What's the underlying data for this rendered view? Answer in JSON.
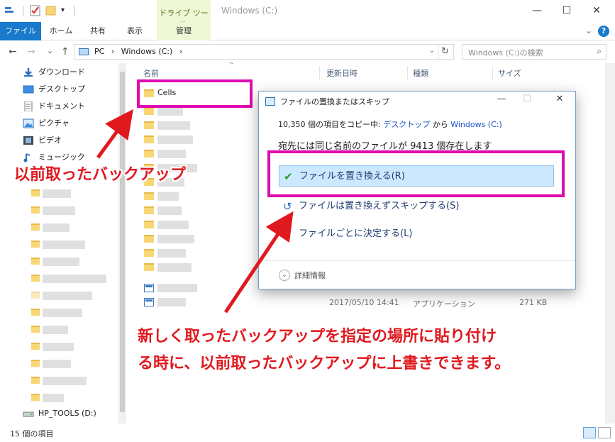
{
  "window": {
    "title": "Windows (C:)",
    "tool_tab": "ドライブ ツール",
    "min": "—",
    "max": "☐",
    "close": "✕"
  },
  "ribbon": {
    "file": "ファイル",
    "home": "ホーム",
    "share": "共有",
    "view": "表示",
    "manage": "管理",
    "chevron": "⌄",
    "help": "?"
  },
  "nav": {
    "back": "←",
    "forward": "→",
    "recent": "⌄",
    "up": "↑",
    "crumbs": [
      "PC",
      "›",
      "Windows (C:)",
      "›"
    ],
    "search_placeholder": "Windows (C:)の検索"
  },
  "sidebar": {
    "items": [
      {
        "label": "ダウンロード",
        "icon": "download-icon"
      },
      {
        "label": "デスクトップ",
        "icon": "desktop-icon"
      },
      {
        "label": "ドキュメント",
        "icon": "documents-icon"
      },
      {
        "label": "ピクチャ",
        "icon": "pictures-icon"
      },
      {
        "label": "ビデオ",
        "icon": "video-icon"
      },
      {
        "label": "ミュージック",
        "icon": "music-icon"
      }
    ],
    "drive": "HP_TOOLS (D:)"
  },
  "columns": {
    "name": "名前",
    "date": "更新日時",
    "type": "種類",
    "size": "サイズ"
  },
  "files": {
    "first_folder": "Cells",
    "last_row": {
      "date": "2017/05/10 14:41",
      "type": "アプリケーション",
      "size": "271 KB"
    }
  },
  "dialog": {
    "title": "ファイルの置換またはスキップ",
    "copying_prefix": "10,350 個の項目をコピー中:",
    "from": "デスクトップ",
    "from_word": "から",
    "to": "Windows (C:)",
    "exists": "宛先には同じ名前のファイルが 9413 個存在します",
    "options": [
      "ファイルを置き換える(R)",
      "ファイルは置き換えずスキップする(S)",
      "ファイルごとに決定する(L)"
    ],
    "details": "詳細情報"
  },
  "annotations": {
    "old_backup": "以前取ったバックアップ",
    "explain_line1": "新しく取ったバックアップを指定の場所に貼り付け",
    "explain_line2": "る時に、以前取ったバックアップに上書きできます。"
  },
  "status": {
    "count": "15 個の項目"
  },
  "colors": {
    "accent": "#1979ca",
    "highlight": "#e008b0",
    "annotation": "#e0191f",
    "selected_option": "#cce8ff"
  }
}
